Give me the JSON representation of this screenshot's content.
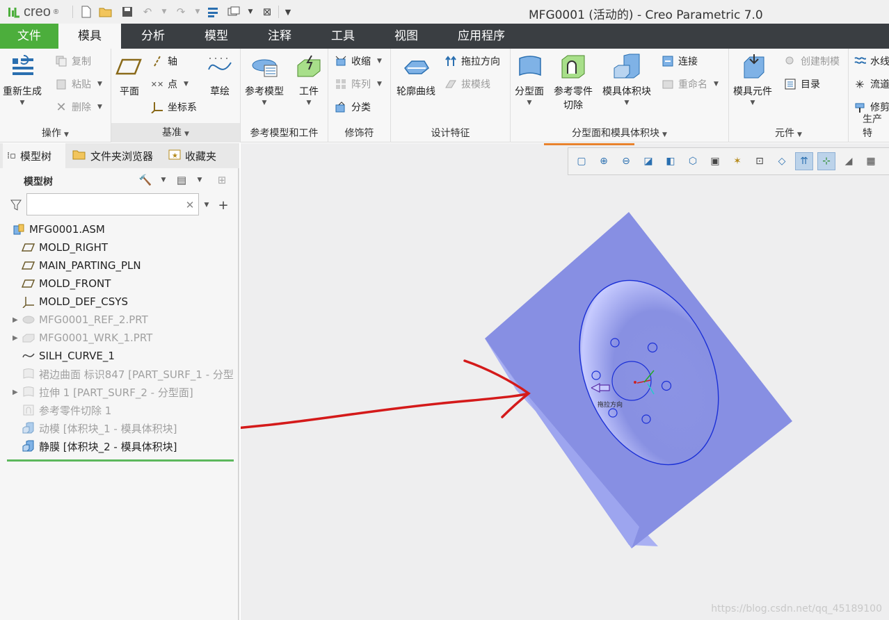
{
  "title_bar": {
    "logo": "creo",
    "window_title": "MFG0001 (活动的) - Creo Parametric 7.0"
  },
  "menu": {
    "tabs": [
      "文件",
      "模具",
      "分析",
      "模型",
      "注释",
      "工具",
      "视图",
      "应用程序"
    ],
    "active": "模具"
  },
  "ribbon": {
    "groups": {
      "operations": "操作",
      "datum": "基准",
      "ref_model": "参考模型和工件",
      "modifiers": "修饰符",
      "design": "设计特征",
      "parting": "分型面和模具体积块",
      "components": "元件",
      "production": "生产特"
    },
    "regenerate": "重新生成",
    "copy": "复制",
    "paste": "粘贴",
    "delete": "删除",
    "plane": "平面",
    "axis": "轴",
    "point": "点",
    "csys": "坐标系",
    "sketch": "草绘",
    "ref_model_btn": "参考模型",
    "workpiece": "工件",
    "shrink": "收缩",
    "pattern": "阵列",
    "classify": "分类",
    "silhouette": "轮廓曲线",
    "pull_dir": "拖拉方向",
    "draft_line": "拔模线",
    "parting_surface": "分型面",
    "ref_part_cutout_1": "参考零件",
    "ref_part_cutout_2": "切除",
    "mold_volume": "模具体积块",
    "connect": "连接",
    "rename": "重命名",
    "mold_component": "模具元件",
    "create_mold": "创建制模",
    "catalog": "目录",
    "water_line": "水线",
    "runner": "流道",
    "trim": "修剪"
  },
  "panel": {
    "tabs": [
      "模型树",
      "文件夹浏览器",
      "收藏夹"
    ],
    "tree_title": "模型树",
    "search_placeholder": "",
    "tree": [
      {
        "label": "MFG0001.ASM",
        "icon": "assembly-icon",
        "dim": false,
        "expander": false
      },
      {
        "label": "MOLD_RIGHT",
        "icon": "datum-plane-icon",
        "dim": false,
        "expander": false
      },
      {
        "label": "MAIN_PARTING_PLN",
        "icon": "datum-plane-icon",
        "dim": false,
        "expander": false
      },
      {
        "label": "MOLD_FRONT",
        "icon": "datum-plane-icon",
        "dim": false,
        "expander": false
      },
      {
        "label": "MOLD_DEF_CSYS",
        "icon": "csys-icon",
        "dim": false,
        "expander": false
      },
      {
        "label": "MFG0001_REF_2.PRT",
        "icon": "ref-part-icon",
        "dim": true,
        "expander": true
      },
      {
        "label": "MFG0001_WRK_1.PRT",
        "icon": "workpiece-icon",
        "dim": true,
        "expander": true
      },
      {
        "label": "SILH_CURVE_1",
        "icon": "curve-icon",
        "dim": false,
        "expander": false
      },
      {
        "label": "裙边曲面 标识847 [PART_SURF_1 - 分型",
        "icon": "surface-icon",
        "dim": true,
        "expander": false
      },
      {
        "label": "拉伸 1 [PART_SURF_2 - 分型面]",
        "icon": "surface-icon",
        "dim": true,
        "expander": true
      },
      {
        "label": "参考零件切除 1",
        "icon": "cutout-icon",
        "dim": true,
        "expander": false
      },
      {
        "label": "动模 [体积块_1 - 模具体积块]",
        "icon": "volume-icon",
        "dim": true,
        "expander": false
      },
      {
        "label": "静膜 [体积块_2 - 模具体积块]",
        "icon": "volume-icon",
        "dim": false,
        "expander": false
      }
    ]
  },
  "graphics": {
    "pull_direction_label": "拖拉方向",
    "watermark": "https://blog.csdn.net/qq_45189100",
    "part_color": "#8a92e6",
    "annotation_color": "#d41a1a"
  }
}
